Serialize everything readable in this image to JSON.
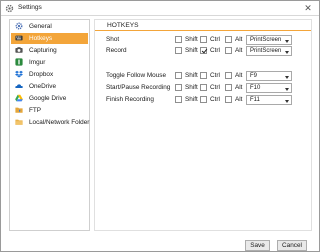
{
  "window": {
    "title": "Settings"
  },
  "sidebar": {
    "items": [
      {
        "label": "General",
        "icon": "gear-icon",
        "color": "#4a6fb5",
        "selected": false
      },
      {
        "label": "Hotkeys",
        "icon": "keyboard-icon",
        "color": "#3c3c3c",
        "selected": true
      },
      {
        "label": "Capturing",
        "icon": "camera-icon",
        "color": "#555555",
        "selected": false
      },
      {
        "label": "Imgur",
        "icon": "imgur-icon",
        "color": "#2b8a3e",
        "selected": false
      },
      {
        "label": "Dropbox",
        "icon": "dropbox-icon",
        "color": "#1f72d6",
        "selected": false
      },
      {
        "label": "OneDrive",
        "icon": "onedrive-icon",
        "color": "#1565c0",
        "selected": false
      },
      {
        "label": "Google Drive",
        "icon": "google-drive-icon",
        "color": "#34a853",
        "selected": false
      },
      {
        "label": "FTP",
        "icon": "ftp-icon",
        "color": "#e5a63a",
        "selected": false
      },
      {
        "label": "Local/Network Folder",
        "icon": "folder-icon",
        "color": "#e9b24a",
        "selected": false
      }
    ],
    "selected_color": "#f3a53a"
  },
  "panel": {
    "title": "HOTKEYS",
    "accent": "#f3a53a",
    "modifiers": {
      "shift": "Shift",
      "ctrl": "Ctrl",
      "alt": "Alt"
    },
    "rows": [
      {
        "label": "Shot",
        "shift": false,
        "ctrl": false,
        "alt": false,
        "key": "PrintScreen"
      },
      {
        "label": "Record",
        "shift": false,
        "ctrl": true,
        "alt": false,
        "key": "PrintScreen"
      },
      {
        "label": "Toggle Follow Mouse",
        "shift": false,
        "ctrl": false,
        "alt": false,
        "key": "F9"
      },
      {
        "label": "Start/Pause Recording",
        "shift": false,
        "ctrl": false,
        "alt": false,
        "key": "F10"
      },
      {
        "label": "Finish Recording",
        "shift": false,
        "ctrl": false,
        "alt": false,
        "key": "F11"
      }
    ]
  },
  "footer": {
    "save_label": "Save",
    "cancel_label": "Cancel"
  }
}
